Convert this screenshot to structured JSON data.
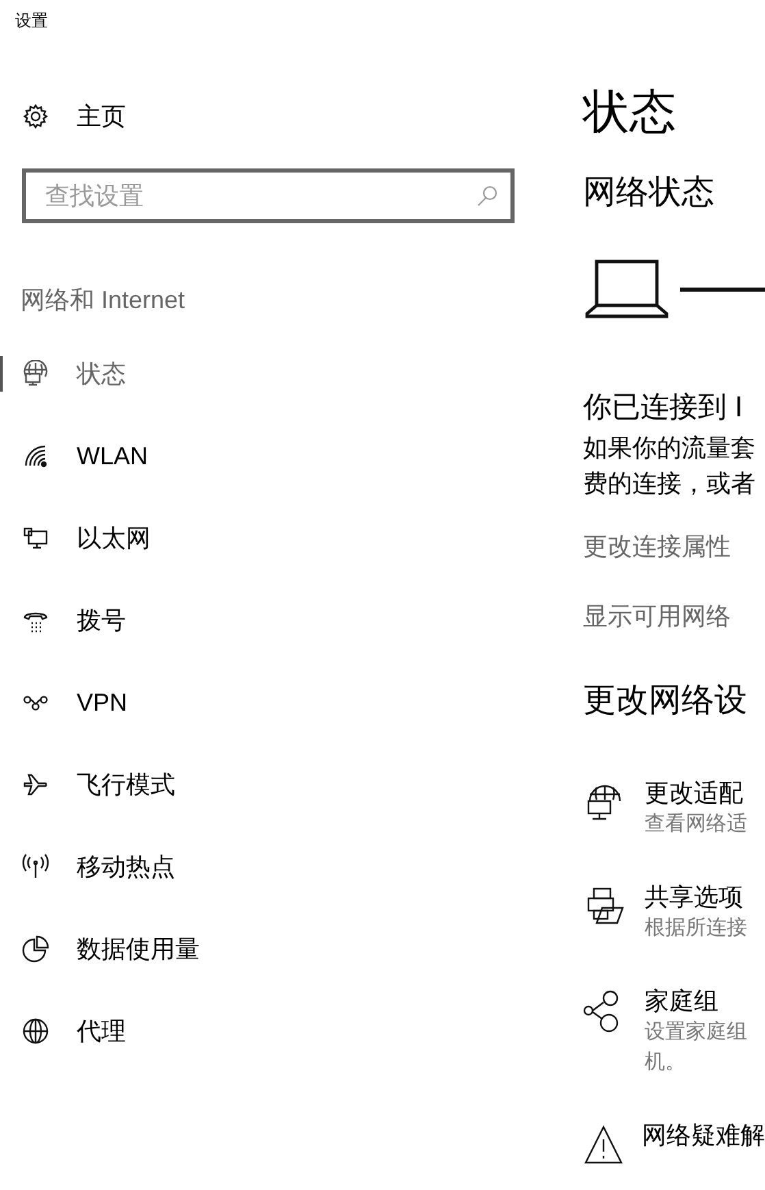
{
  "window": {
    "title": "设置"
  },
  "sidebar": {
    "home": {
      "label": "主页"
    },
    "search": {
      "placeholder": "查找设置"
    },
    "section": "网络和 Internet",
    "items": [
      {
        "label": "状态",
        "kind": "status",
        "selected": true
      },
      {
        "label": "WLAN",
        "kind": "wifi",
        "selected": false
      },
      {
        "label": "以太网",
        "kind": "ethernet",
        "selected": false
      },
      {
        "label": "拨号",
        "kind": "dialup",
        "selected": false
      },
      {
        "label": "VPN",
        "kind": "vpn",
        "selected": false
      },
      {
        "label": "飞行模式",
        "kind": "airplane",
        "selected": false
      },
      {
        "label": "移动热点",
        "kind": "hotspot",
        "selected": false
      },
      {
        "label": "数据使用量",
        "kind": "data",
        "selected": false
      },
      {
        "label": "代理",
        "kind": "globe",
        "selected": false
      }
    ]
  },
  "main": {
    "title": "状态",
    "network_heading": "网络状态",
    "connected_title": "你已连接到 I",
    "connected_text": [
      "如果你的流量套",
      "费的连接，或者"
    ],
    "links": [
      "更改连接属性",
      "显示可用网络"
    ],
    "settings_heading": "更改网络设",
    "options": [
      {
        "kind": "adapter",
        "title": "更改适配",
        "description": [
          "查看网络适"
        ]
      },
      {
        "kind": "sharing",
        "title": "共享选项",
        "description": [
          "根据所连接"
        ]
      },
      {
        "kind": "homegroup",
        "title": "家庭组",
        "description": [
          "设置家庭组",
          "机。"
        ]
      },
      {
        "kind": "warning",
        "title": "网络疑难解"
      }
    ]
  }
}
